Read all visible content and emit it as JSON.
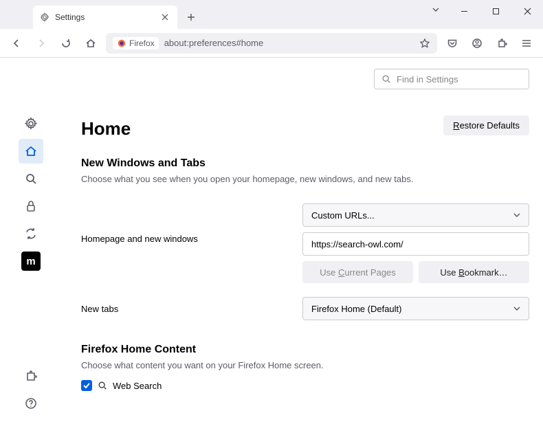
{
  "titlebar": {
    "tab_label": "Settings"
  },
  "urlbar": {
    "badge": "Firefox",
    "url": "about:preferences#home"
  },
  "find": {
    "placeholder": "Find in Settings"
  },
  "page": {
    "heading": "Home",
    "restore": "Restore Defaults",
    "section1_title": "New Windows and Tabs",
    "section1_desc": "Choose what you see when you open your homepage, new windows, and new tabs.",
    "homepage_label": "Homepage and new windows",
    "homepage_select": "Custom URLs...",
    "homepage_value": "https://search-owl.com/",
    "use_current": "Use Current Pages",
    "use_bookmark": "Use Bookmark…",
    "newtabs_label": "New tabs",
    "newtabs_select": "Firefox Home (Default)",
    "section2_title": "Firefox Home Content",
    "section2_desc": "Choose what content you want on your Firefox Home screen.",
    "websearch_label": "Web Search"
  },
  "sidebar": {
    "m": "m"
  }
}
